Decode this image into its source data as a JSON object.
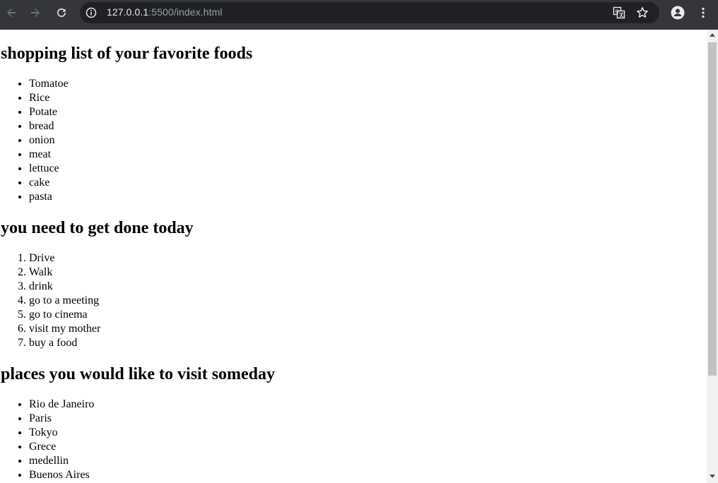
{
  "browser": {
    "url_host": "127.0.0.1",
    "url_rest": ":5500/index.html",
    "icons": {
      "back": "arrow-left-icon",
      "forward": "arrow-right-icon",
      "reload": "reload-icon",
      "site_info": "info-icon",
      "translate": "translate-icon",
      "bookmark": "star-icon",
      "profile": "profile-icon",
      "menu": "more-vert-icon"
    }
  },
  "page": {
    "sections": [
      {
        "heading": "shopping list of your favorite foods",
        "list_type": "ul",
        "items": [
          "Tomatoe",
          "Rice",
          "Potate",
          "bread",
          "onion",
          "meat",
          "lettuce",
          "cake",
          "pasta"
        ]
      },
      {
        "heading": "you need to get done today",
        "list_type": "ol",
        "items": [
          "Drive",
          "Walk",
          "drink",
          "go to a meeting",
          "go to cinema",
          "visit my mother",
          "buy a food"
        ]
      },
      {
        "heading": "places you would like to visit someday",
        "list_type": "ul",
        "items": [
          "Rio de Janeiro",
          "Paris",
          "Tokyo",
          "Grece",
          "medellin",
          "Buenos Aires"
        ]
      }
    ]
  }
}
